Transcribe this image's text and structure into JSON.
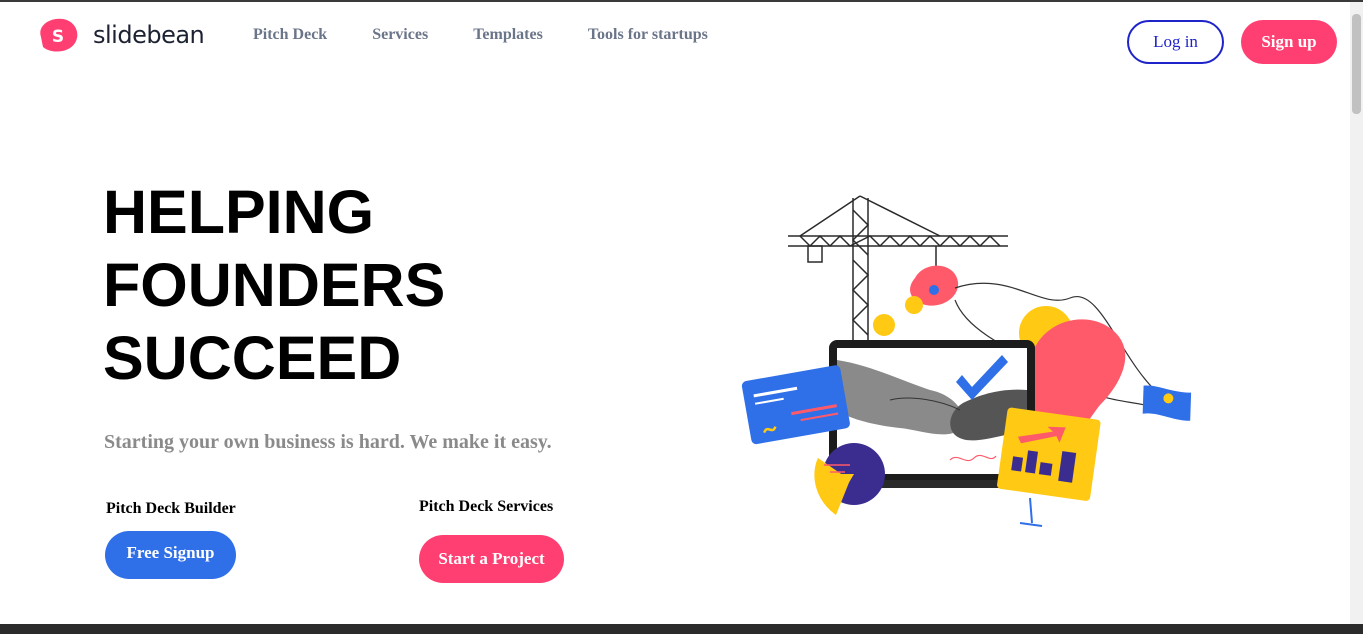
{
  "brand": {
    "name": "slidebean",
    "mark_letter": "S",
    "color": "#ff3f72"
  },
  "nav": {
    "items": [
      "Pitch Deck",
      "Services",
      "Templates",
      "Tools for startups"
    ]
  },
  "auth": {
    "login": "Log in",
    "signup": "Sign up"
  },
  "hero": {
    "title_lines": [
      "HELPING",
      "FOUNDERS",
      "SUCCEED"
    ],
    "subtitle": "Starting your own business is hard. We make it easy."
  },
  "cta": {
    "builder_label": "Pitch Deck Builder",
    "builder_button": "Free Signup",
    "services_label": "Pitch Deck Services",
    "services_button": "Start a Project"
  },
  "illustration": {
    "icon": "handshake-laptop-crane-icon"
  },
  "colors": {
    "primary_blue": "#2f6fe8",
    "accent_pink": "#ff3f72",
    "login_border": "#1e24c9"
  }
}
